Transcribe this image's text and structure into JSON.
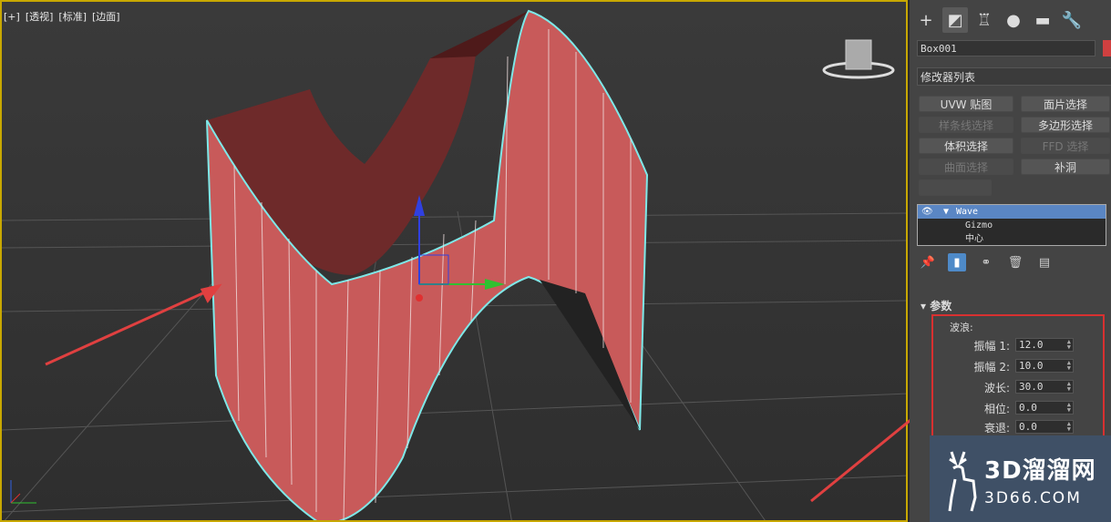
{
  "viewport": {
    "labels": [
      "[+]",
      "[透视]",
      "[标准]",
      "[边面]"
    ]
  },
  "command_panel": {
    "tabs": [
      {
        "name": "create",
        "glyph": "+"
      },
      {
        "name": "modify",
        "glyph": "◩"
      },
      {
        "name": "hierarchy",
        "glyph": "♖"
      },
      {
        "name": "motion",
        "glyph": "●"
      },
      {
        "name": "display",
        "glyph": "▬"
      },
      {
        "name": "utilities",
        "glyph": "🔧"
      }
    ],
    "object_name": "Box001",
    "object_color": "#d04040",
    "modifier_list": "修改器列表",
    "buttons": [
      {
        "label": "UVW 贴图",
        "enabled": true
      },
      {
        "label": "面片选择",
        "enabled": true
      },
      {
        "label": "样条线选择",
        "enabled": false
      },
      {
        "label": "多边形选择",
        "enabled": true
      },
      {
        "label": "体积选择",
        "enabled": true
      },
      {
        "label": "FFD 选择",
        "enabled": false
      },
      {
        "label": "曲面选择",
        "enabled": false
      },
      {
        "label": "补洞",
        "enabled": true
      }
    ],
    "stack": [
      {
        "label": "Wave",
        "selected": true
      },
      {
        "label": "Gizmo",
        "selected": false
      },
      {
        "label": "中心",
        "selected": false
      }
    ],
    "rollout_title": "参数",
    "group_label": "波浪:",
    "params": [
      {
        "label": "振幅 1:",
        "value": "12.0"
      },
      {
        "label": "振幅 2:",
        "value": "10.0"
      },
      {
        "label": "波长:",
        "value": "30.0"
      },
      {
        "label": "相位:",
        "value": "0.0"
      },
      {
        "label": "衰退:",
        "value": "0.0"
      }
    ]
  },
  "watermark": {
    "title": "3D溜溜网",
    "url": "3D66.COM"
  },
  "colors": {
    "mesh": "#c85a5a",
    "mesh_dark": "#7a2e2e",
    "selection_outline": "#7ee8e8",
    "highlight_box": "#d83030",
    "arrow": "#e04040"
  }
}
